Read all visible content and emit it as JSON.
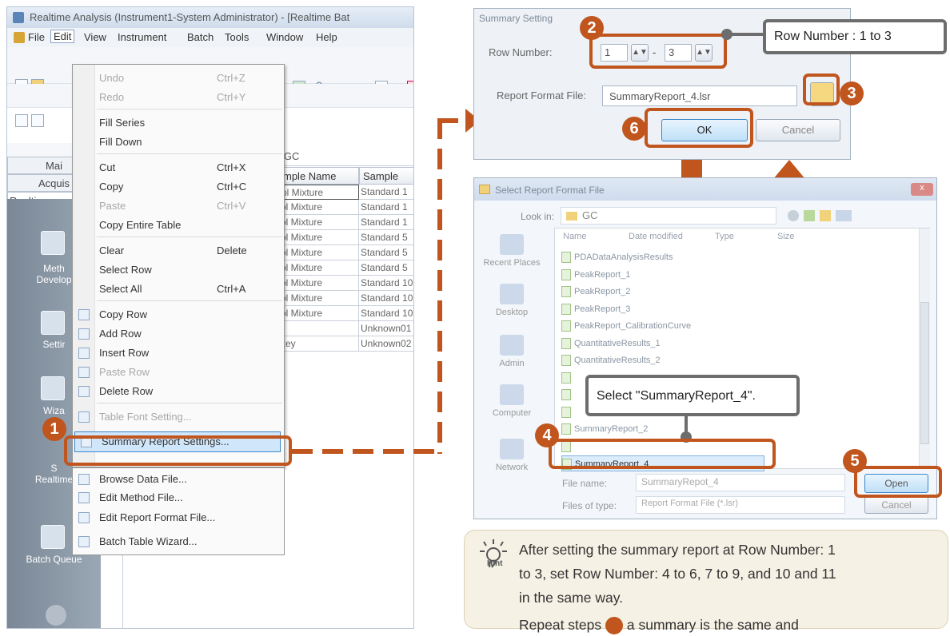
{
  "app": {
    "title": "Realtime Analysis (Instrument1-System Administrator) - [Realtime Bat",
    "menus": [
      "File",
      "Edit",
      "View",
      "Instrument",
      "Batch",
      "Tools",
      "Window",
      "Help"
    ],
    "help_glyph": "?",
    "tabs": [
      "Mai",
      "Acquis",
      "Realtime"
    ],
    "nav": [
      "Meth\nDevelop",
      "Settir",
      "Wiza",
      "S\nRealtime",
      "Batch Queue"
    ],
    "path": "e\\GC",
    "grid": {
      "columns": [
        "mple Name",
        "Sample"
      ],
      "rows": [
        [
          "ol Mixture",
          "Standard  1"
        ],
        [
          "ol Mixture",
          "Standard  1"
        ],
        [
          "ol Mixture",
          "Standard  1"
        ],
        [
          "ol Mixture",
          "Standard  5"
        ],
        [
          "ol Mixture",
          "Standard  5"
        ],
        [
          "ol Mixture",
          "Standard  5"
        ],
        [
          "ol Mixture",
          "Standard 10"
        ],
        [
          "ol Mixture",
          "Standard 10"
        ],
        [
          "ol Mixture",
          "Standard 10"
        ],
        [
          "r",
          "Unknown01"
        ],
        [
          "key",
          "Unknown02"
        ]
      ]
    }
  },
  "edit_menu": [
    {
      "label": "Undo",
      "shortcut": "Ctrl+Z",
      "disabled": true
    },
    {
      "label": "Redo",
      "shortcut": "Ctrl+Y",
      "disabled": true
    },
    {
      "label": "Fill Series"
    },
    {
      "label": "Fill Down"
    },
    {
      "label": "Cut",
      "shortcut": "Ctrl+X"
    },
    {
      "label": "Copy",
      "shortcut": "Ctrl+C"
    },
    {
      "label": "Paste",
      "shortcut": "Ctrl+V",
      "disabled": true
    },
    {
      "label": "Copy Entire Table"
    },
    {
      "label": "Clear",
      "shortcut": "Delete"
    },
    {
      "label": "Select Row"
    },
    {
      "label": "Select All",
      "shortcut": "Ctrl+A"
    },
    {
      "label": "Copy Row"
    },
    {
      "label": "Add Row"
    },
    {
      "label": "Insert Row"
    },
    {
      "label": "Paste Row",
      "disabled": true
    },
    {
      "label": "Delete Row"
    },
    {
      "label": "Table Font Setting...",
      "disabled": true
    },
    {
      "label": "Summary Report Settings...",
      "selected": true
    }
  ],
  "extra_menu": [
    {
      "label": "Browse Data File..."
    },
    {
      "label": "Edit Method File..."
    },
    {
      "label": "Edit Report Format File..."
    },
    {
      "label": "Batch Table Wizard..."
    }
  ],
  "summary_dialog": {
    "title": "Summary Setting",
    "row_number_label": "Row Number:",
    "row_from": "1",
    "row_dash": "-",
    "row_to": "3",
    "report_format_label": "Report Format File:",
    "report_format_value": "SummaryReport_4.lsr",
    "ok": "OK",
    "cancel": "Cancel"
  },
  "file_dialog": {
    "title": "Select Report Format File",
    "look_in_label": "Look in:",
    "look_in_value": "GC",
    "columns": [
      "Name",
      "Date modified",
      "Type",
      "Size"
    ],
    "places": [
      "Recent Places",
      "Desktop",
      "Admin",
      "Computer",
      "Network"
    ],
    "files": [
      "PDADataAnalysisResults",
      "PeakReport_1",
      "PeakReport_2",
      "PeakReport_3",
      "PeakReport_CalibrationCurve",
      "QuantitativeResults_1",
      "QuantitativeResults_2",
      "",
      "",
      "",
      "SummaryReport_2",
      "",
      "SummaryReport_4"
    ],
    "file_name_label": "File name:",
    "file_name_value": "SummaryRepot_4",
    "file_type_label": "Files of type:",
    "file_type_value": "Report Format File (*.lsr)",
    "open": "Open",
    "cancel": "Cancel"
  },
  "callouts": {
    "badges": [
      "1",
      "2",
      "3",
      "4",
      "5",
      "6"
    ],
    "row_number_note": "Row Number : 1 to 3",
    "select_note": "Select \"SummaryReport_4\"."
  },
  "hint": {
    "label": "Hint",
    "text_lines": [
      "After setting the summary report at Row Number: 1",
      "to 3, set Row Number: 4 to 6, 7 to 9, and 10 and 11",
      "in the same way."
    ],
    "cut_line": "Repeat steps",
    "cut_line_end": "a summary is the same and"
  },
  "colors": {
    "accent": "#c0551d",
    "callout_gray": "#6d6d6d",
    "hint_bg": "#f6f1e5"
  }
}
